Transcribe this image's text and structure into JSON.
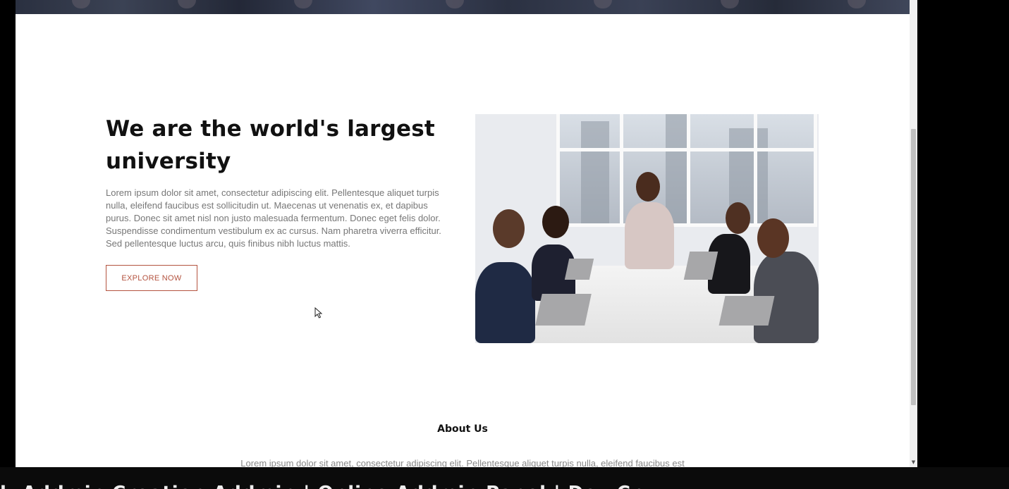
{
  "section": {
    "headline": "We are the world's largest university",
    "body": "Lorem ipsum dolor sit amet, consectetur adipiscing elit. Pellentesque aliquet turpis nulla, eleifend faucibus est sollicitudin ut. Maecenas ut venenatis ex, et dapibus purus. Donec sit amet nisl non justo malesuada fermentum. Donec eget felis dolor. Suspendisse condimentum vestibulum ex ac cursus. Nam pharetra viverra efficitur. Sed pellentesque luctus arcu, quis finibus nibh luctus mattis.",
    "button_label": "EXPLORE NOW",
    "image_icon": "meeting-photo"
  },
  "about": {
    "title": "About Us",
    "text": "Lorem ipsum dolor sit amet, consectetur adipiscing elit. Pellentesque aliquet turpis nulla, eleifend faucibus est"
  },
  "bottom_band": {
    "text": "l: Addmin Creation Addmin | Online Addmin Panel | Dev Cr"
  },
  "colors": {
    "accent": "#b4533f",
    "heading": "#111111",
    "body_text": "#777777"
  }
}
